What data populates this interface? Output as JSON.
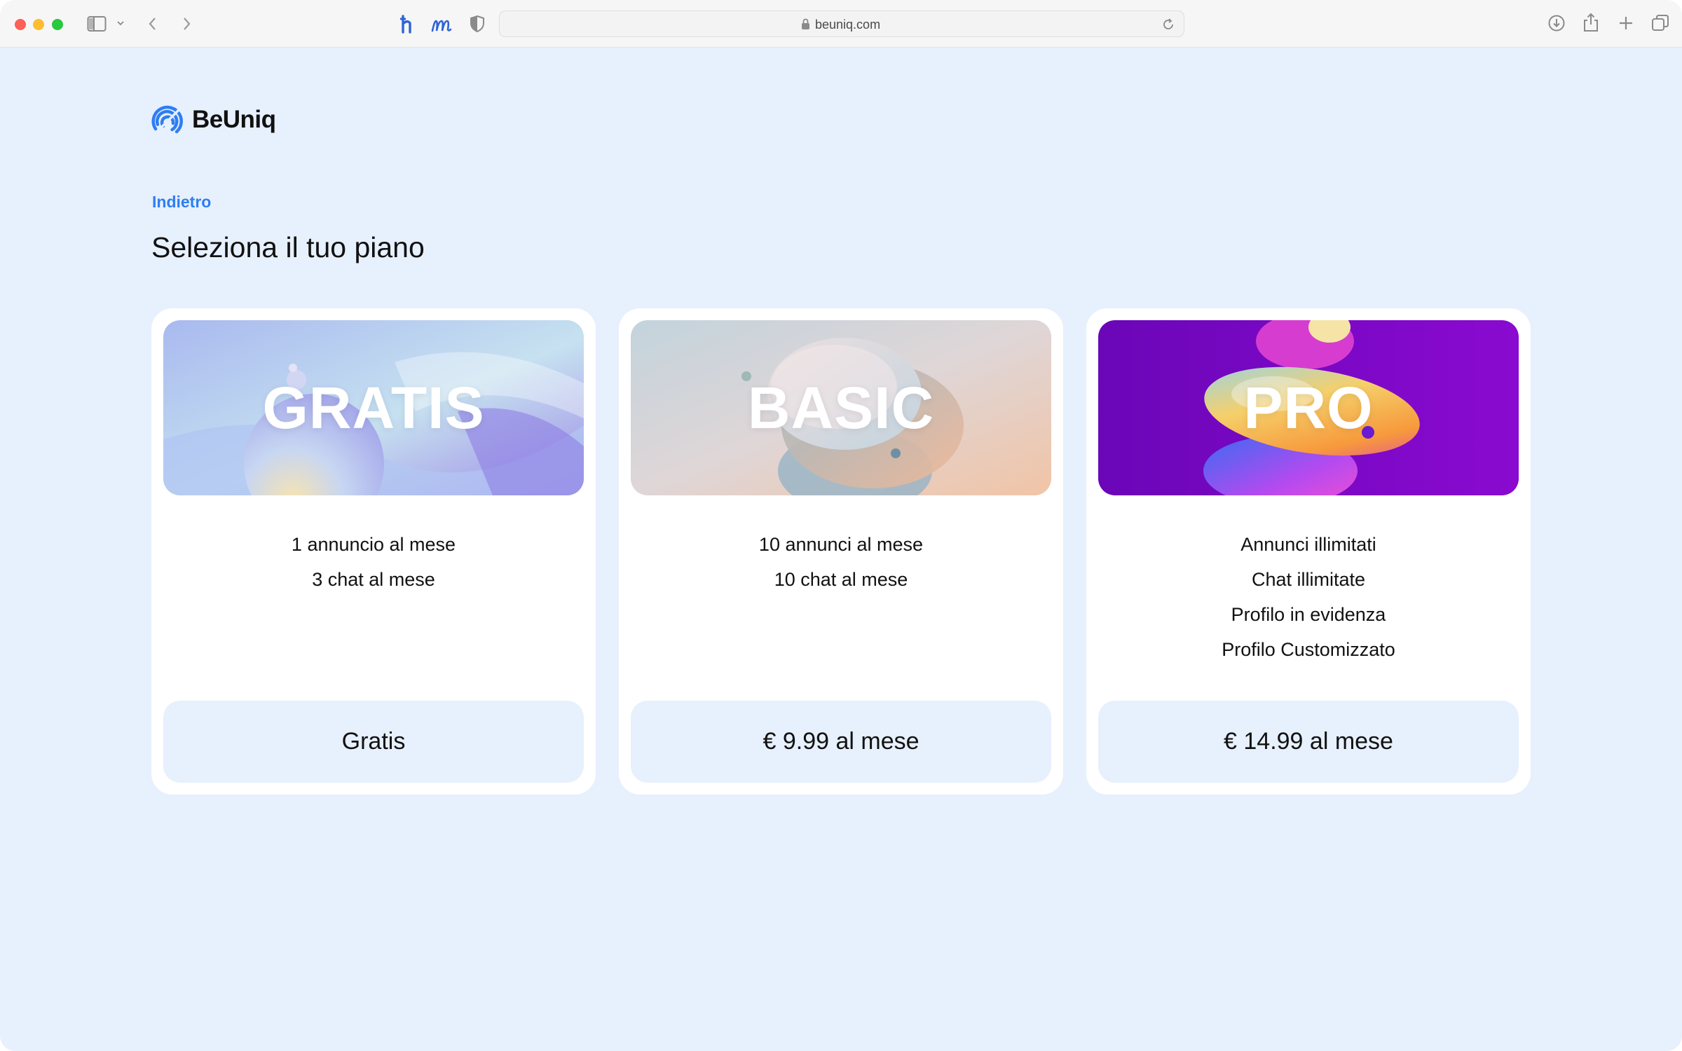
{
  "browser": {
    "url": "beuniq.com",
    "icons": [
      "sidebar-icon",
      "chevron-down-icon",
      "back-arrow-icon",
      "forward-arrow-icon",
      "hypothesis-extension-icon",
      "m-extension-icon",
      "shield-icon",
      "lock-icon",
      "reload-icon",
      "download-icon",
      "share-icon",
      "new-tab-icon",
      "tabs-overview-icon"
    ]
  },
  "brand": {
    "name": "BeUniq",
    "accent": "#2e7ef2"
  },
  "nav": {
    "back_label": "Indietro"
  },
  "page": {
    "title": "Seleziona il tuo piano",
    "background": "#e7f0fd"
  },
  "plans": [
    {
      "name": "GRATIS",
      "features": [
        "1 annuncio al mese",
        "3 chat al mese"
      ],
      "price_label": "Gratis"
    },
    {
      "name": "BASIC",
      "features": [
        "10 annunci al mese",
        "10 chat al mese"
      ],
      "price_label": "€ 9.99 al mese"
    },
    {
      "name": "PRO",
      "features": [
        "Annunci illimitati",
        "Chat illimitate",
        "Profilo in evidenza",
        "Profilo Customizzato"
      ],
      "price_label": "€ 14.99 al mese"
    }
  ]
}
